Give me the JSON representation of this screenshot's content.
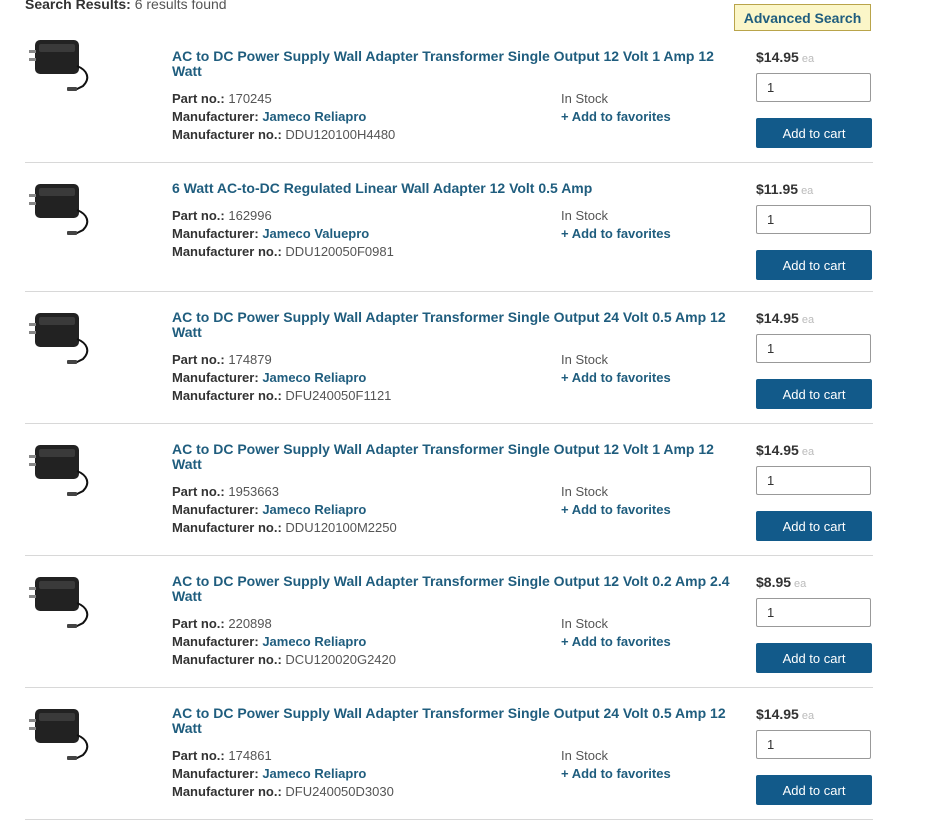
{
  "header": {
    "label": "Search Results:",
    "count_text": "6 results found",
    "advanced_search": "Advanced Search"
  },
  "labels": {
    "part_no": "Part no.:",
    "manufacturer": "Manufacturer:",
    "manufacturer_no": "Manufacturer no.:",
    "add_to_favorites": "+ Add to favorites",
    "add_to_cart": "Add to cart",
    "unit": "ea"
  },
  "products": [
    {
      "title": "AC to DC Power Supply Wall Adapter Transformer Single Output 12 Volt 1 Amp 12 Watt",
      "part_no": "170245",
      "manufacturer": "Jameco Reliapro",
      "manufacturer_no": "DDU120100H4480",
      "stock": "In Stock",
      "price": "$14.95",
      "qty": "1",
      "image_icon": "power-adapter-icon"
    },
    {
      "title": "6 Watt AC-to-DC Regulated Linear Wall Adapter 12 Volt 0.5 Amp",
      "part_no": "162996",
      "manufacturer": "Jameco Valuepro",
      "manufacturer_no": "DDU120050F0981",
      "stock": "In Stock",
      "price": "$11.95",
      "qty": "1",
      "image_icon": "power-adapter-icon"
    },
    {
      "title": "AC to DC Power Supply Wall Adapter Transformer Single Output 24 Volt 0.5 Amp 12 Watt",
      "part_no": "174879",
      "manufacturer": "Jameco Reliapro",
      "manufacturer_no": "DFU240050F1121",
      "stock": "In Stock",
      "price": "$14.95",
      "qty": "1",
      "image_icon": "power-adapter-icon"
    },
    {
      "title": "AC to DC Power Supply Wall Adapter Transformer Single Output 12 Volt 1 Amp 12 Watt",
      "part_no": "1953663",
      "manufacturer": "Jameco Reliapro",
      "manufacturer_no": "DDU120100M2250",
      "stock": "In Stock",
      "price": "$14.95",
      "qty": "1",
      "image_icon": "power-adapter-icon"
    },
    {
      "title": "AC to DC Power Supply Wall Adapter Transformer Single Output 12 Volt 0.2 Amp 2.4 Watt",
      "part_no": "220898",
      "manufacturer": "Jameco Reliapro",
      "manufacturer_no": "DCU120020G2420",
      "stock": "In Stock",
      "price": "$8.95",
      "qty": "1",
      "image_icon": "power-adapter-icon"
    },
    {
      "title": "AC to DC Power Supply Wall Adapter Transformer Single Output 24 Volt 0.5 Amp 12 Watt",
      "part_no": "174861",
      "manufacturer": "Jameco Reliapro",
      "manufacturer_no": "DFU240050D3030",
      "stock": "In Stock",
      "price": "$14.95",
      "qty": "1",
      "image_icon": "power-adapter-icon"
    }
  ]
}
